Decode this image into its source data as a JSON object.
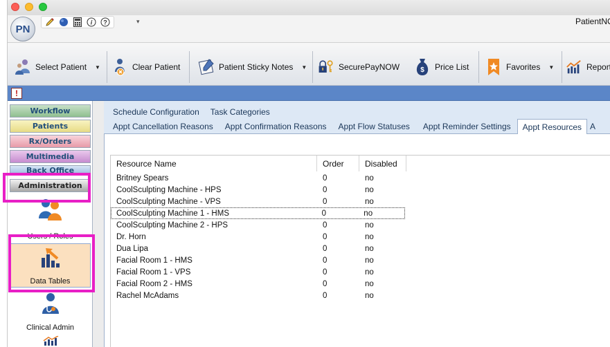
{
  "app": {
    "title": "PatientNOW",
    "logo_text": "PN"
  },
  "quick_access": {
    "icons": [
      "pencil-icon",
      "globe-icon",
      "calculator-icon",
      "info-icon",
      "help-icon"
    ],
    "info_glyph": "i",
    "help_glyph": "?",
    "dropdown": "▾"
  },
  "ribbon": {
    "select_patient": "Select Patient",
    "clear_patient": "Clear Patient",
    "sticky_notes": "Patient Sticky Notes",
    "securepay": "SecurePayNOW",
    "price_list": "Price List",
    "favorites": "Favorites",
    "reports": "Reports",
    "caret": "▼"
  },
  "alert": {
    "glyph": "!"
  },
  "sidebar": {
    "nav": {
      "workflow": "Workflow",
      "patients": "Patients",
      "rx_orders": "Rx/Orders",
      "multimedia": "Multimedia",
      "back_office": "Back Office",
      "administration": "Administration"
    },
    "items": {
      "users_roles": "Users / Roles",
      "data_tables": "Data Tables",
      "clinical_admin": "Clinical Admin"
    }
  },
  "tabs": {
    "row1": [
      "Schedule Configuration",
      "Task Categories"
    ],
    "row2": [
      "Appt Cancellation Reasons",
      "Appt Confirmation Reasons",
      "Appt Flow Statuses",
      "Appt Reminder Settings",
      "Appt Resources",
      "A"
    ],
    "active": "Appt Resources"
  },
  "grid": {
    "headers": {
      "name": "Resource Name",
      "order": "Order",
      "disabled": "Disabled"
    },
    "rows": [
      {
        "name": "Britney Spears",
        "order": "0",
        "disabled": "no"
      },
      {
        "name": "CoolSculpting Machine - HPS",
        "order": "0",
        "disabled": "no"
      },
      {
        "name": "CoolSculpting Machine - VPS",
        "order": "0",
        "disabled": "no"
      },
      {
        "name": "CoolSculpting Machine 1 - HMS",
        "order": "0",
        "disabled": "no"
      },
      {
        "name": "CoolSculpting Machine 2 - HPS",
        "order": "0",
        "disabled": "no"
      },
      {
        "name": "Dr. Horn",
        "order": "0",
        "disabled": "no"
      },
      {
        "name": "Dua Lipa",
        "order": "0",
        "disabled": "no"
      },
      {
        "name": "Facial Room 1 - HMS",
        "order": "0",
        "disabled": "no"
      },
      {
        "name": "Facial Room 1 - VPS",
        "order": "0",
        "disabled": "no"
      },
      {
        "name": "Facial Room 2 - HMS",
        "order": "0",
        "disabled": "no"
      },
      {
        "name": "Rachel McAdams",
        "order": "0",
        "disabled": "no"
      }
    ],
    "selected_row": "CoolSculpting Machine 1 - HMS"
  },
  "colors": {
    "highlight": "#e81fc6",
    "ribbon_bar": "#5b86c8",
    "content_bg": "#dde8f5"
  }
}
